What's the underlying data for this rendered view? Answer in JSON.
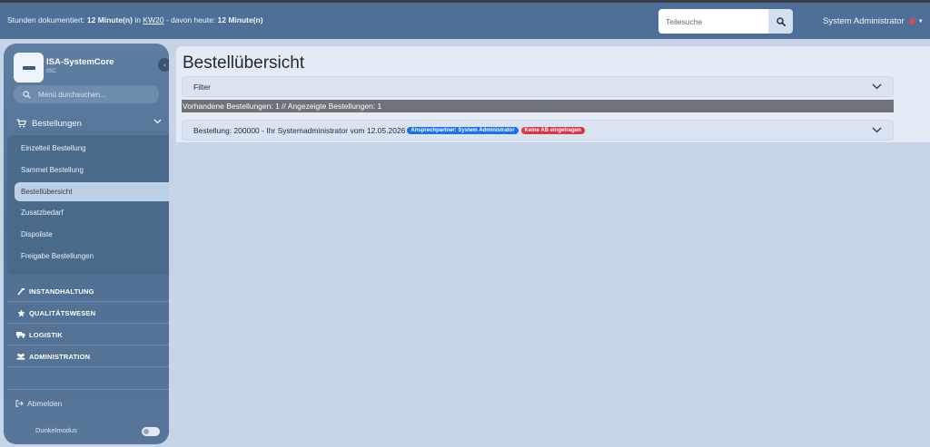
{
  "topbar": {
    "info_prefix": "Stunden dokumentiert: ",
    "hours_total": "12 Minute(n)",
    "in_text": " in ",
    "week_link": "KW20",
    "today_text": " - davon heute: ",
    "hours_today": "12 Minute(n)",
    "search_placeholder": "Teilesuche",
    "user_name": "System Administrator"
  },
  "sidebar": {
    "brand_name": "ISA-SystemCore",
    "brand_sub": "ISC",
    "menu_search_placeholder": "Menü durchsuchen...",
    "section_label": "Bestellungen",
    "subitems": [
      {
        "label": "Einzelteil Bestellung"
      },
      {
        "label": "Sammel Bestellung"
      },
      {
        "label": "Bestellübersicht"
      },
      {
        "label": "Zusatzbedarf"
      },
      {
        "label": "Dispoliste"
      },
      {
        "label": "Freigabe Bestellungen"
      }
    ],
    "main_items": [
      {
        "label": "INSTANDHALTUNG"
      },
      {
        "label": "QUALITÄTSWESEN"
      },
      {
        "label": "LOGISTIK"
      },
      {
        "label": "ADMINISTRATION"
      }
    ],
    "logout_label": "Abmelden",
    "darkmode_label": "Dunkelmodus"
  },
  "main": {
    "page_title": "Bestellübersicht",
    "filter_label": "Filter",
    "summary_text": "Vorhandene Bestellungen: 1 // Angezeigte Bestellungen: 1",
    "order_title": "Bestellung: 200000 - Ihr Systemadministrator vom 12.05.2026",
    "badge_contact": "Ansprechpartner: System Administrator",
    "badge_ab": "Keine AB eingetragen"
  },
  "colors": {
    "topbar": "#4e7098",
    "badge_blue": "#1c6ff0",
    "badge_red": "#dc3545",
    "summary_bar": "#6e7378"
  }
}
